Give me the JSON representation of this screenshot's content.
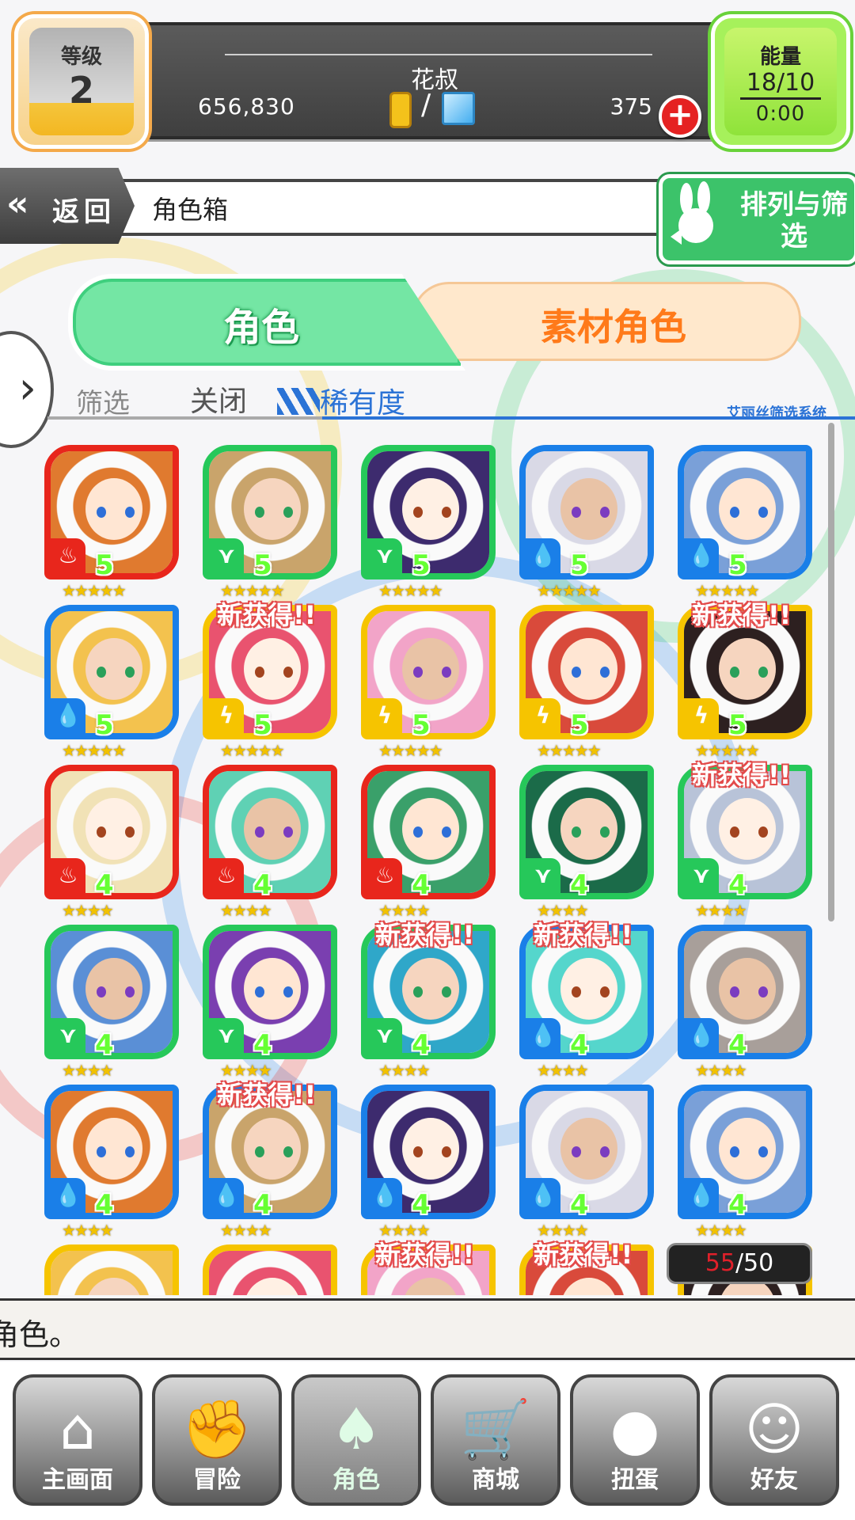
{
  "status": {
    "level_label": "等级",
    "level_value": "2",
    "player_name": "花叔",
    "gold": "656,830",
    "separator": "/",
    "gems": "375",
    "energy_label": "能量",
    "energy_value": "18/10",
    "energy_timer": "0:00"
  },
  "header": {
    "back_label": "返回",
    "title": "角色箱",
    "sort_label": "排列与筛选"
  },
  "tabs": {
    "characters": "角色",
    "materials": "素材角色"
  },
  "filter": {
    "label": "筛选",
    "value": "关闭",
    "sort": "稀有度",
    "system": "艾丽丝筛选系统"
  },
  "cards": [
    {
      "frame": "#e8261c",
      "elem": "fire",
      "new": false,
      "rarity": "5",
      "stars": "★★★★★"
    },
    {
      "frame": "#26c85a",
      "elem": "wind",
      "new": false,
      "rarity": "5",
      "stars": "★★★★★"
    },
    {
      "frame": "#26c85a",
      "elem": "wind",
      "new": false,
      "rarity": "5",
      "stars": "★★★★★"
    },
    {
      "frame": "#1a7fe8",
      "elem": "water",
      "new": false,
      "rarity": "5",
      "stars": "★★★★★"
    },
    {
      "frame": "#1a7fe8",
      "elem": "water",
      "new": false,
      "rarity": "5",
      "stars": "★★★★★"
    },
    {
      "frame": "#1a7fe8",
      "elem": "water",
      "new": false,
      "rarity": "5",
      "stars": "★★★★★"
    },
    {
      "frame": "#f6c400",
      "elem": "thunder",
      "new": true,
      "rarity": "5",
      "stars": "★★★★★"
    },
    {
      "frame": "#f6c400",
      "elem": "thunder",
      "new": false,
      "rarity": "5",
      "stars": "★★★★★"
    },
    {
      "frame": "#f6c400",
      "elem": "thunder",
      "new": false,
      "rarity": "5",
      "stars": "★★★★★"
    },
    {
      "frame": "#f6c400",
      "elem": "thunder",
      "new": true,
      "rarity": "5",
      "stars": "★★★★★"
    },
    {
      "frame": "#e8261c",
      "elem": "fire",
      "new": false,
      "rarity": "4",
      "stars": "★★★★"
    },
    {
      "frame": "#e8261c",
      "elem": "fire",
      "new": false,
      "rarity": "4",
      "stars": "★★★★"
    },
    {
      "frame": "#e8261c",
      "elem": "fire",
      "new": false,
      "rarity": "4",
      "stars": "★★★★"
    },
    {
      "frame": "#26c85a",
      "elem": "wind",
      "new": false,
      "rarity": "4",
      "stars": "★★★★"
    },
    {
      "frame": "#26c85a",
      "elem": "wind",
      "new": true,
      "rarity": "4",
      "stars": "★★★★"
    },
    {
      "frame": "#26c85a",
      "elem": "wind",
      "new": false,
      "rarity": "4",
      "stars": "★★★★"
    },
    {
      "frame": "#26c85a",
      "elem": "wind",
      "new": false,
      "rarity": "4",
      "stars": "★★★★"
    },
    {
      "frame": "#26c85a",
      "elem": "wind",
      "new": true,
      "rarity": "4",
      "stars": "★★★★"
    },
    {
      "frame": "#1a7fe8",
      "elem": "water",
      "new": true,
      "rarity": "4",
      "stars": "★★★★"
    },
    {
      "frame": "#1a7fe8",
      "elem": "water",
      "new": false,
      "rarity": "4",
      "stars": "★★★★"
    },
    {
      "frame": "#1a7fe8",
      "elem": "water",
      "new": false,
      "rarity": "4",
      "stars": "★★★★"
    },
    {
      "frame": "#1a7fe8",
      "elem": "water",
      "new": true,
      "rarity": "4",
      "stars": "★★★★"
    },
    {
      "frame": "#1a7fe8",
      "elem": "water",
      "new": false,
      "rarity": "4",
      "stars": "★★★★"
    },
    {
      "frame": "#1a7fe8",
      "elem": "water",
      "new": false,
      "rarity": "4",
      "stars": "★★★★"
    },
    {
      "frame": "#1a7fe8",
      "elem": "water",
      "new": false,
      "rarity": "4",
      "stars": "★★★★"
    },
    {
      "frame": "#f6c400",
      "elem": "thunder",
      "new": false,
      "rarity": "",
      "stars": ""
    },
    {
      "frame": "#f6c400",
      "elem": "thunder",
      "new": false,
      "rarity": "",
      "stars": ""
    },
    {
      "frame": "#f6c400",
      "elem": "thunder",
      "new": true,
      "rarity": "",
      "stars": ""
    },
    {
      "frame": "#f6c400",
      "elem": "thunder",
      "new": true,
      "rarity": "",
      "stars": ""
    },
    {
      "frame": "#f6c400",
      "elem": "thunder",
      "new": false,
      "rarity": "",
      "stars": ""
    }
  ],
  "new_label": "新获得!!",
  "count": {
    "current": "55",
    "sep": "/",
    "max": "50"
  },
  "message": "角色。",
  "nav": [
    {
      "label": "主画面",
      "icon": "house-icon",
      "glyph": "⌂"
    },
    {
      "label": "冒险",
      "icon": "handshake-icon",
      "glyph": "✊"
    },
    {
      "label": "角色",
      "icon": "bunny-icon",
      "glyph": "♠"
    },
    {
      "label": "商城",
      "icon": "cart-icon",
      "glyph": "🛒"
    },
    {
      "label": "扭蛋",
      "icon": "egg-icon",
      "glyph": "●"
    },
    {
      "label": "好友",
      "icon": "friends-icon",
      "glyph": "☺"
    }
  ],
  "colors": {
    "fire": "#e8261c",
    "wind": "#26c85a",
    "water": "#1a7fe8",
    "thunder": "#f6c400"
  },
  "element_glyphs": {
    "fire": "♨",
    "wind": "⋎",
    "water": "💧",
    "thunder": "ϟ"
  }
}
